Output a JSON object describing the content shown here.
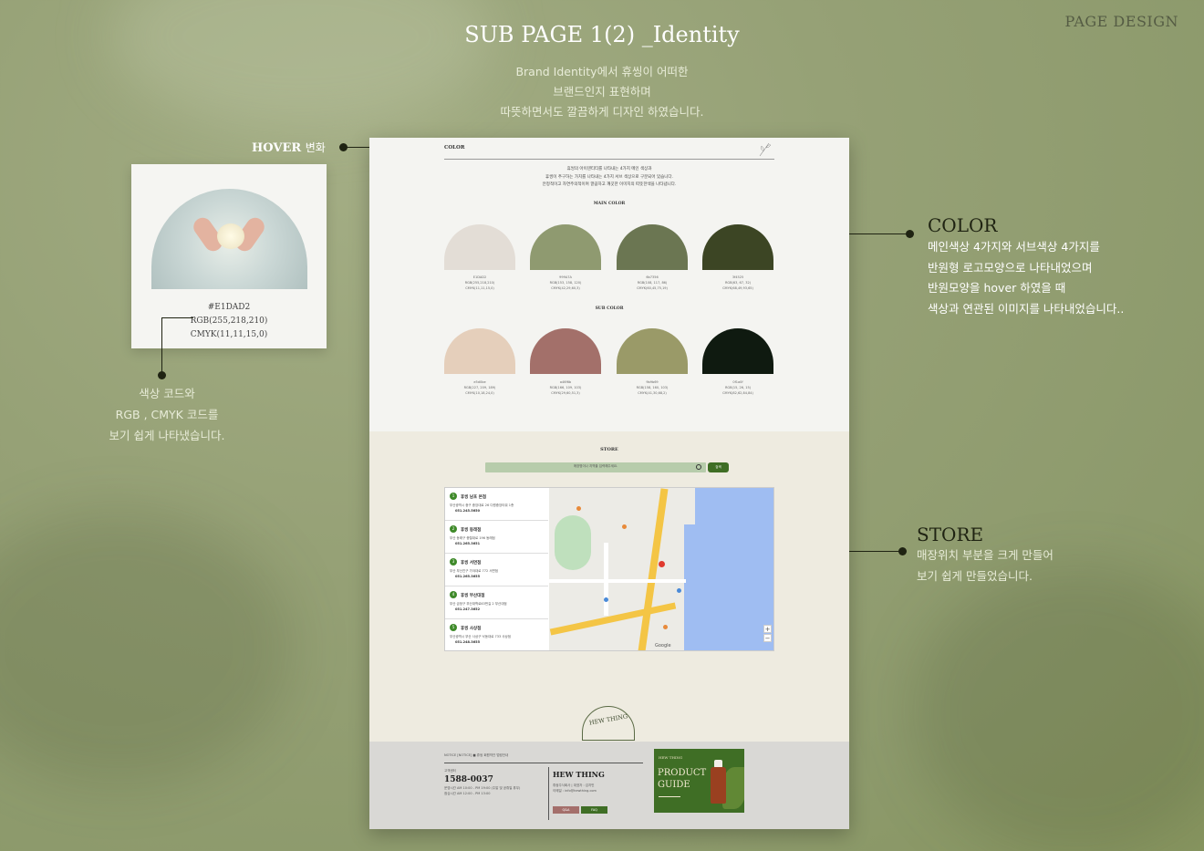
{
  "header": {
    "corner_label": "PAGE DESIGN",
    "title": "SUB PAGE 1(2) _Identity",
    "subtitle_lines": [
      "Brand Identity에서 휴씽이 어떠한",
      "브랜드인지 표현하며",
      "따뜻하면서도 깔끔하게 디자인 하였습니다."
    ]
  },
  "hover_callout": {
    "label_en": "HOVER",
    "label_ko": "변화",
    "code_hex": "#E1DAD2",
    "code_rgb": "RGB(255,218,210)",
    "code_cmyk": "CMYK(11,11,15,0)",
    "caption_lines": [
      "색상 코드와",
      "RGB , CMYK 코드를",
      "보기 쉽게 나타냈습니다."
    ]
  },
  "color_callout": {
    "title": "COLOR",
    "lines": [
      "메인색상 4가지와 서브색상 4가지를",
      "반원형 로고모양으로 나타내었으며",
      "반원모양을 hover 하였을 때",
      "색상과 연관된 이미지를 나타내었습니다.."
    ]
  },
  "store_callout": {
    "title": "STORE",
    "lines": [
      "매장위치 부분을 크게 만들어",
      "보기 쉽게 만들었습니다."
    ]
  },
  "page": {
    "color_heading": "COLOR",
    "intro_lines": [
      "휴씽의 아이덴티티를 나타내는 4가지 메인 색상과",
      "휴씽이 추구하는 가치를 나타내는 4가지 서브 색상으로 구분되어 있습니다.",
      "안정적이고 자연주의적이며 깔끔하고 깨끗한 이미지의 따뜻한색을 나타냅니다."
    ],
    "main_label": "MAIN COLOR",
    "sub_label": "SUB COLOR",
    "main_colors": [
      {
        "color": "#e3ddd6",
        "hex": "E1DAD2",
        "rgb": "RGB(255,218,210)",
        "cmyk": "CMYK(11,11,15,0)"
      },
      {
        "color": "#8f9a70",
        "hex": "999A7A",
        "rgb": "RGB(153, 158, 120)",
        "cmyk": "CMYK(42,29,60,3)"
      },
      {
        "color": "#6b7652",
        "hex": "6b7356",
        "rgb": "RGB(108, 117, 86)",
        "cmyk": "CMYK(60,45,75,19)"
      },
      {
        "color": "#3c4524",
        "hex": "3f4525",
        "rgb": "RGB(63, 67, 32)",
        "cmyk": "CMYK(68,49,93,65)"
      }
    ],
    "sub_colors": [
      {
        "color": "#e5cfbb",
        "hex": "e5d0be",
        "rgb": "RGB(227, 209, 189)",
        "cmyk": "CMYK(10,18,24,0)"
      },
      {
        "color": "#a3706a",
        "hex": "a46f6b",
        "rgb": "RGB(166, 109, 103)",
        "cmyk": "CMYK(29,60,51,3)"
      },
      {
        "color": "#9a9a68",
        "hex": "9b9b69",
        "rgb": "RGB(158, 160, 103)",
        "cmyk": "CMYK(41,30,68,2)"
      },
      {
        "color": "#0f1a10",
        "hex": "0f1a0f",
        "rgb": "RGB(15, 26, 15)",
        "cmyk": "CMYK(82,62,84,84)"
      }
    ],
    "store_heading": "STORE",
    "search_placeholder": "매장명이나 지역을 입력해주세요.",
    "search_button": "검색",
    "stores": [
      {
        "num": "1",
        "name": "휴씽 남포 본점",
        "address": "부산광역시 중구 중앙대로 26 다원중앙타워 1층",
        "tel": "051.245.5650"
      },
      {
        "num": "2",
        "name": "휴씽 동래점",
        "address": "부산 동래구 충렬대로 196 동래점",
        "tel": "051.265.3651"
      },
      {
        "num": "3",
        "name": "휴씽 서면점",
        "address": "부산 부산진구 가야대로 772 서면점",
        "tel": "051.265.3655"
      },
      {
        "num": "4",
        "name": "휴씽 부산대점",
        "address": "부산 금정구 부산대학로63번길 2 부산대점",
        "tel": "051.247.3652"
      },
      {
        "num": "5",
        "name": "휴씽 사상점",
        "address": "부산광역시 부산 사상구 낙동대로 733 사상점",
        "tel": "051.248.3655"
      }
    ],
    "map_google": "Google",
    "logo_text": "HEW THING",
    "footer": {
      "notice": "NOTICE [NOTICE] ■ 휴씽 회원약관 법령안내",
      "cs_label": "고객센터",
      "phone": "1588-0037",
      "hours_lines": [
        "운영시간 AM 10:00 - PM 19:00 (주말 및 공휴일 휴무)",
        "점심시간 AM 12:00 - PM 13:00"
      ],
      "brand": "HEW THING",
      "company_lines": [
        "휴씽주식회사 | 대표자 : 김지민",
        "이메일 : info@hewthing.com"
      ],
      "btn_qna": "Q&A",
      "btn_faq": "FAQ",
      "banner_small": "HEW THING",
      "banner_title_1": "PRODUCT",
      "banner_title_2": "GUIDE"
    }
  },
  "colors": {
    "accent_green": "#3f6e25",
    "qna": "#a46f6b"
  }
}
